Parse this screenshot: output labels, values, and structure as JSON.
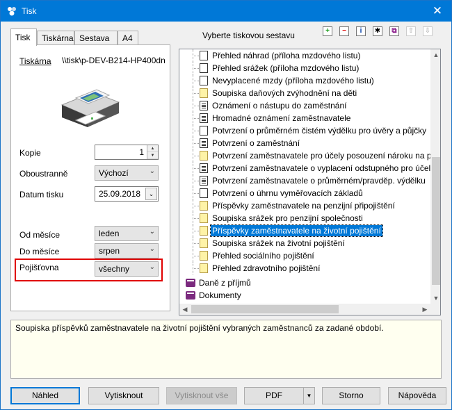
{
  "window": {
    "title": "Tisk",
    "close_glyph": "✕"
  },
  "tabs": [
    "Tisk",
    "Tiskárna",
    "Sestava",
    "A4"
  ],
  "left": {
    "printer_label": "Tiskárna",
    "printer_value": "\\\\tisk\\p-DEV-B214-HP400dn",
    "copies_label": "Kopie",
    "copies_value": "1",
    "duplex_label": "Oboustranně",
    "duplex_value": "Výchozí",
    "date_label": "Datum tisku",
    "date_value": "25.09.2018",
    "from_month_label": "Od měsíce",
    "from_month_value": "leden",
    "to_month_label": "Do měsíce",
    "to_month_value": "srpen",
    "insurer_label": "Pojišťovna",
    "insurer_value": "všechny"
  },
  "right": {
    "heading": "Vyberte tiskovou sestavu",
    "toolbar": [
      "+",
      "−",
      "i",
      "✱",
      "⧉",
      "⇧",
      "⇩"
    ],
    "items": [
      {
        "label": "Přehled náhrad (příloha mzdového listu)",
        "icon": "white-doc"
      },
      {
        "label": "Přehled srážek (příloha mzdového listu)",
        "icon": "white-doc"
      },
      {
        "label": "Nevyplacené mzdy (příloha mzdového listu)",
        "icon": "white-doc"
      },
      {
        "label": "Soupiska daňových zvýhodnění na děti",
        "icon": "yellow-doc"
      },
      {
        "label": "Oznámení o nástupu do zaměstnání",
        "icon": "form-doc"
      },
      {
        "label": "Hromadné oznámení zaměstnavatele",
        "icon": "form-doc"
      },
      {
        "label": "Potvrzení o průměrném čistém výdělku pro úvěry a půjčky",
        "icon": "white-doc"
      },
      {
        "label": "Potvrzení o zaměstnání",
        "icon": "form-doc"
      },
      {
        "label": "Potvrzení zaměstnavatele pro účely posouzení nároku na p",
        "icon": "yellow-doc"
      },
      {
        "label": "Potvrzení zaměstnavatele o vyplacení odstupného pro účel",
        "icon": "form-doc"
      },
      {
        "label": "Potvrzení zaměstnavatele o průměrném/pravděp. výdělku",
        "icon": "form-doc"
      },
      {
        "label": "Potvrzení o úhrnu vyměřovacích základů",
        "icon": "white-doc"
      },
      {
        "label": "Příspěvky zaměstnavatele na penzijní připojištění",
        "icon": "yellow-doc"
      },
      {
        "label": "Soupiska srážek pro penzijní společnosti",
        "icon": "yellow-doc"
      },
      {
        "label": "Příspěvky zaměstnavatele na životní pojištění",
        "icon": "yellow-doc",
        "selected": true
      },
      {
        "label": "Soupiska srážek na životní pojištění",
        "icon": "yellow-doc"
      },
      {
        "label": "Přehled sociálního pojištění",
        "icon": "yellow-doc"
      },
      {
        "label": "Přehled zdravotního pojištění",
        "icon": "yellow-doc"
      }
    ],
    "groups": [
      "Daně z příjmů",
      "Dokumenty"
    ]
  },
  "description": "Soupiska příspěvků zaměstnavatele na životní pojištění vybraných zaměstnanců za zadané období.",
  "buttons": {
    "preview": "Náhled",
    "print": "Vytisknout",
    "print_all": "Vytisknout vše",
    "pdf": "PDF",
    "cancel": "Storno",
    "help": "Nápověda"
  }
}
